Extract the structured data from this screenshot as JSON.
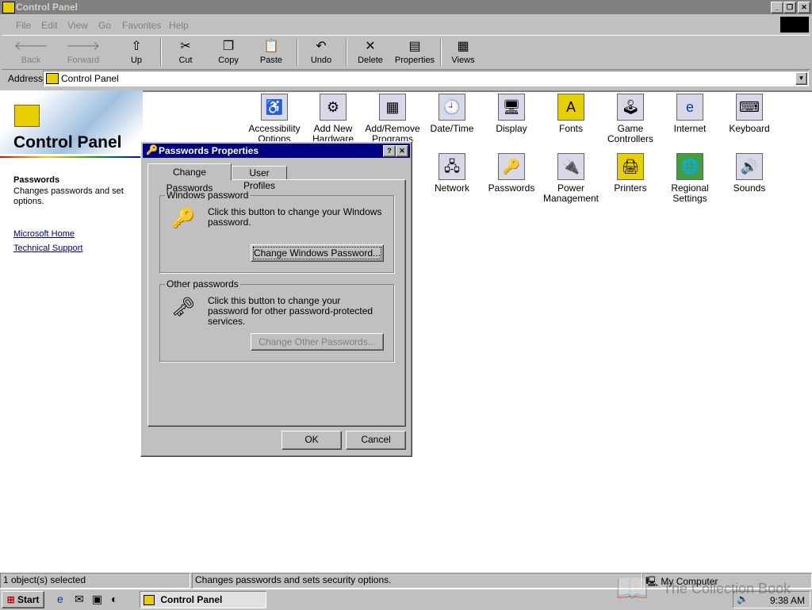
{
  "window": {
    "title": "Control Panel"
  },
  "menu": [
    "File",
    "Edit",
    "View",
    "Go",
    "Favorites",
    "Help"
  ],
  "toolbar": {
    "back": "Back",
    "forward": "Forward",
    "up": "Up",
    "cut": "Cut",
    "copy": "Copy",
    "paste": "Paste",
    "undo": "Undo",
    "delete": "Delete",
    "properties": "Properties",
    "views": "Views"
  },
  "address": {
    "label": "Address",
    "value": "Control Panel"
  },
  "left_pane": {
    "title": "Control Panel",
    "selected_name": "Passwords",
    "selected_desc": "Changes passwords and set options.",
    "links": [
      "Microsoft Home",
      "Technical Support"
    ]
  },
  "icons": [
    {
      "label": "Accessibility Options",
      "icon": "accessibility-icon"
    },
    {
      "label": "Add New Hardware",
      "icon": "hardware-icon"
    },
    {
      "label": "Add/Remove Programs",
      "icon": "programs-icon"
    },
    {
      "label": "Date/Time",
      "icon": "clock-icon"
    },
    {
      "label": "Display",
      "icon": "display-icon"
    },
    {
      "label": "Fonts",
      "icon": "fonts-folder-icon"
    },
    {
      "label": "Game Controllers",
      "icon": "joystick-icon"
    },
    {
      "label": "Internet",
      "icon": "internet-icon"
    },
    {
      "label": "Keyboard",
      "icon": "keyboard-icon"
    },
    {
      "label": "Network",
      "icon": "network-icon"
    },
    {
      "label": "Passwords",
      "icon": "keys-icon"
    },
    {
      "label": "Power Management",
      "icon": "power-icon"
    },
    {
      "label": "Printers",
      "icon": "printer-folder-icon"
    },
    {
      "label": "Regional Settings",
      "icon": "globe-icon"
    },
    {
      "label": "Sounds",
      "icon": "speaker-icon"
    }
  ],
  "dialog": {
    "title": "Passwords Properties",
    "tabs": [
      "Change Passwords",
      "User Profiles"
    ],
    "windows_group": "Windows password",
    "windows_text": "Click this button to change your Windows password.",
    "windows_button": "Change Windows Password...",
    "other_group": "Other passwords",
    "other_text": "Click this button to change your password for other password-protected services.",
    "other_button": "Change Other Passwords...",
    "ok": "OK",
    "cancel": "Cancel"
  },
  "status": {
    "selected": "1 object(s) selected",
    "description": "Changes passwords and sets security options.",
    "zone": "My Computer"
  },
  "taskbar": {
    "start": "Start",
    "task": "Control Panel",
    "time": "9:38 AM"
  },
  "watermark": "The Collection Book"
}
